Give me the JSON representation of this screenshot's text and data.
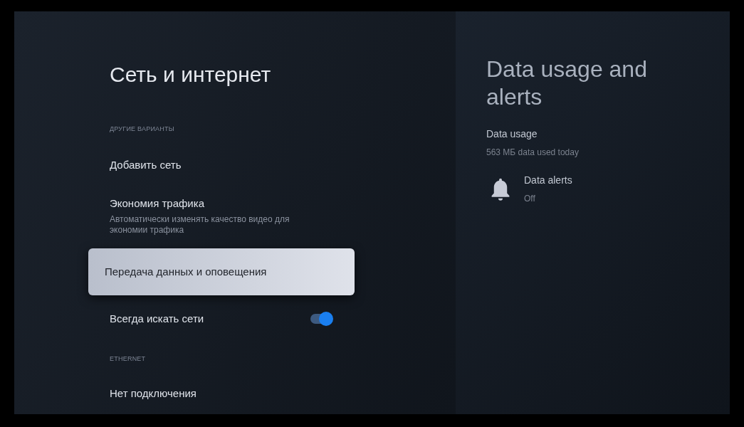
{
  "left_panel": {
    "title": "Сеть и интернет",
    "items": [
      {
        "kind": "header",
        "label": "ДРУГИЕ ВАРИАНТЫ"
      },
      {
        "kind": "item",
        "label": "Добавить сеть",
        "selected": false
      },
      {
        "kind": "item",
        "label": "Экономия трафика",
        "subtitle": "Автоматически изменять качество видео для экономии трафика",
        "selected": false
      },
      {
        "kind": "item",
        "label": "Передача данных и оповещения",
        "selected": true
      },
      {
        "kind": "toggle",
        "label": "Всегда искать сети",
        "on": true,
        "selected": false
      },
      {
        "kind": "header",
        "label": "ETHERNET"
      },
      {
        "kind": "item",
        "label": "Нет подключения",
        "selected": false
      }
    ]
  },
  "right_panel": {
    "title": "Data usage and alerts",
    "entries": [
      {
        "kind": "plain",
        "label": "Data usage",
        "subtitle": "563 МБ data used today"
      },
      {
        "kind": "bell",
        "label": "Data alerts",
        "subtitle": "Off"
      }
    ]
  }
}
